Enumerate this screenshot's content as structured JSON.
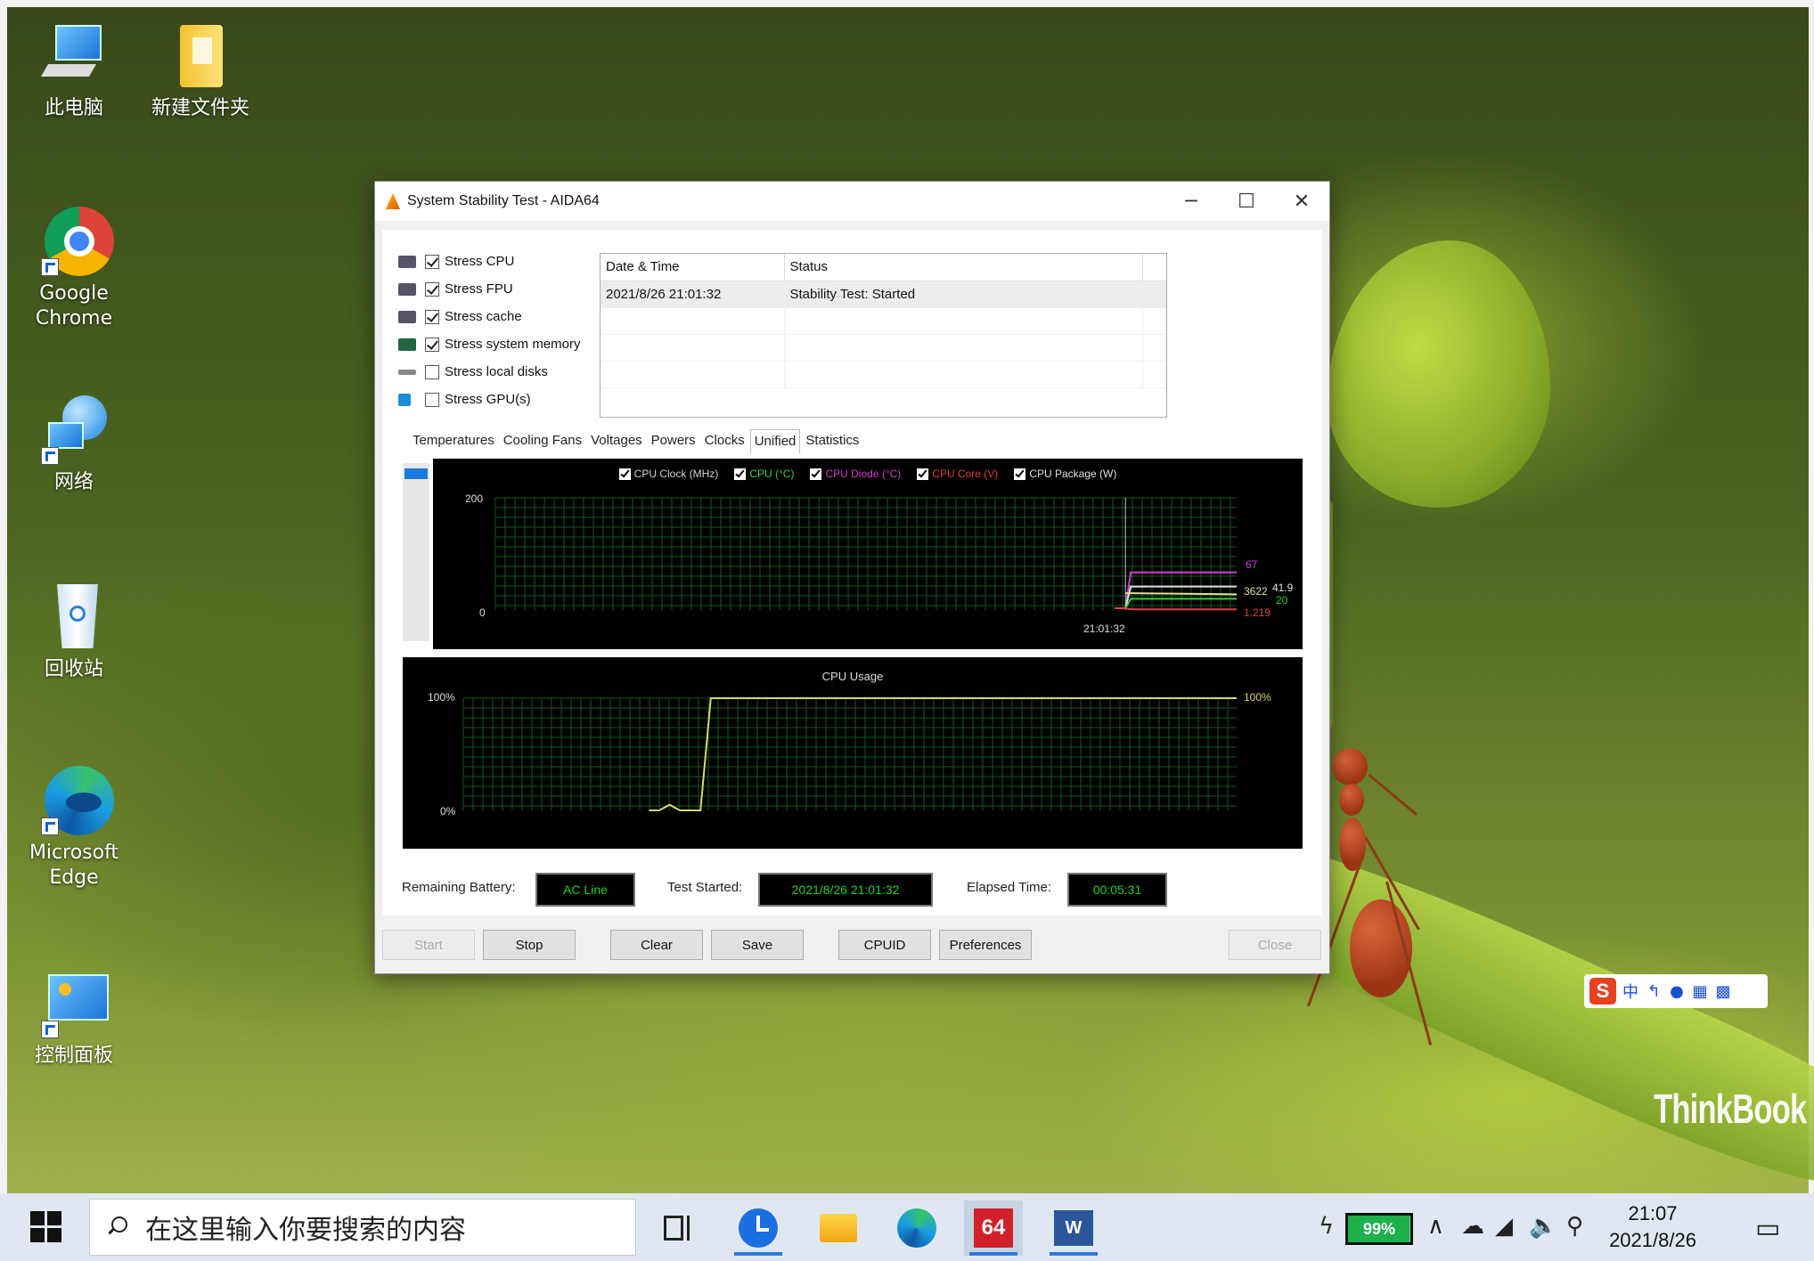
{
  "desktop": {
    "icons": [
      {
        "label": "此电脑"
      },
      {
        "label": "新建文件夹"
      },
      {
        "label": "Google Chrome"
      },
      {
        "label": "网络"
      },
      {
        "label": "回收站"
      },
      {
        "label": "Microsoft Edge"
      },
      {
        "label": "控制面板"
      }
    ],
    "brand_text": "ThinkBook",
    "ime_toolbar": {
      "logo": "S",
      "items": [
        "中",
        "↰",
        "mic",
        "keyboard",
        "grid"
      ]
    }
  },
  "window": {
    "title": "System Stability Test - AIDA64",
    "controls": {
      "minimize": "─",
      "maximize": "☐",
      "close": "✕"
    },
    "stress_options": [
      {
        "label": "Stress CPU",
        "checked": true
      },
      {
        "label": "Stress FPU",
        "checked": true
      },
      {
        "label": "Stress cache",
        "checked": true
      },
      {
        "label": "Stress system memory",
        "checked": true
      },
      {
        "label": "Stress local disks",
        "checked": false
      },
      {
        "label": "Stress GPU(s)",
        "checked": false
      }
    ],
    "log": {
      "headers": [
        "Date & Time",
        "Status"
      ],
      "rows": [
        [
          "2021/8/26 21:01:32",
          "Stability Test: Started"
        ]
      ]
    },
    "tabs": [
      "Temperatures",
      "Cooling Fans",
      "Voltages",
      "Powers",
      "Clocks",
      "Unified",
      "Statistics"
    ],
    "active_tab": "Unified",
    "unified_graph": {
      "legend": [
        {
          "label": "CPU Clock (MHz)",
          "color": "#d0d0d0"
        },
        {
          "label": "CPU (°C)",
          "color": "#33d033"
        },
        {
          "label": "CPU Diode (°C)",
          "color": "#d040d0"
        },
        {
          "label": "CPU Core (V)",
          "color": "#e04040"
        },
        {
          "label": "CPU Package (W)",
          "color": "#e0e0e0"
        }
      ],
      "y_max_label": "200",
      "y_min_label": "0",
      "time_label": "21:01:32",
      "right_values": {
        "diode": "67",
        "clock": "3622",
        "package": "41.9",
        "cpu": "20",
        "core": "1.219"
      },
      "colors": {
        "grid": "#0f5a1a",
        "line": "#ffffff"
      }
    },
    "cpu_usage_graph": {
      "title": "CPU Usage",
      "y_max_label": "100%",
      "y_min_label": "0%",
      "right_value": "100%",
      "line_color": "#d8d86a"
    },
    "status": {
      "battery_label": "Remaining Battery:",
      "battery_value": "AC Line",
      "started_label": "Test Started:",
      "started_value": "2021/8/26 21:01:32",
      "elapsed_label": "Elapsed Time:",
      "elapsed_value": "00:05:31"
    },
    "buttons": {
      "start": "Start",
      "stop": "Stop",
      "clear": "Clear",
      "save": "Save",
      "cpuid": "CPUID",
      "preferences": "Preferences",
      "close": "Close"
    }
  },
  "chart_data": [
    {
      "type": "line",
      "title": "",
      "ylim": [
        0,
        200
      ],
      "x": [
        "21:01:32"
      ],
      "series": [
        {
          "name": "CPU Clock (MHz)",
          "values": [
            3622
          ]
        },
        {
          "name": "CPU (°C)",
          "values": [
            20
          ]
        },
        {
          "name": "CPU Diode (°C)",
          "values": [
            67
          ]
        },
        {
          "name": "CPU Core (V)",
          "values": [
            1.219
          ]
        },
        {
          "name": "CPU Package (W)",
          "values": [
            41.9
          ]
        }
      ]
    },
    {
      "type": "line",
      "title": "CPU Usage",
      "ylim": [
        0,
        100
      ],
      "series": [
        {
          "name": "",
          "values": [
            0,
            0,
            5,
            0,
            0,
            0,
            100,
            100,
            100,
            100,
            100,
            100,
            100,
            100,
            100,
            100,
            100,
            100,
            100,
            100,
            100,
            100
          ]
        }
      ]
    }
  ],
  "taskbar": {
    "search_placeholder": "在这里输入你要搜索的内容",
    "apps": [
      "task-view",
      "clock-app",
      "file-explorer",
      "edge",
      "aida64",
      "word"
    ],
    "aida_label": "64",
    "battery": "99%",
    "time": "21:07",
    "date": "2021/8/26"
  }
}
